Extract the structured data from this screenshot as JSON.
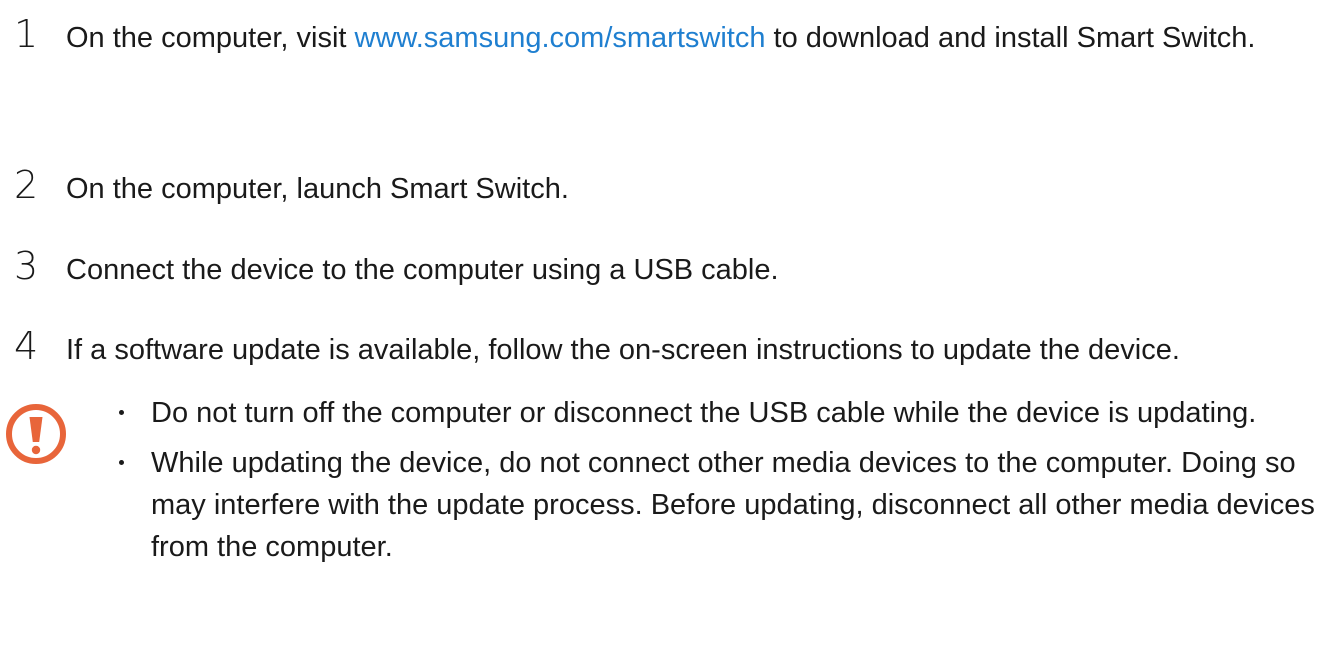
{
  "steps": [
    {
      "number": "1",
      "text_before": "On the computer, visit ",
      "link_text": "www.samsung.com/smartswitch",
      "text_after": " to download and install Smart Switch."
    },
    {
      "number": "2",
      "text": "On the computer, launch Smart Switch."
    },
    {
      "number": "3",
      "text": "Connect the device to the computer using a USB cable."
    },
    {
      "number": "4",
      "text": "If a software update is available, follow the on-screen instructions to update the device."
    }
  ],
  "notice": {
    "icon": "warning-exclamation-icon",
    "icon_color": "#e8653a",
    "bullets": [
      "Do not turn off the computer or disconnect the USB cable while the device is updating.",
      "While updating the device, do not connect other media devices to the computer. Doing so may interfere with the update process. Before updating, disconnect all other media devices from the computer."
    ]
  },
  "colors": {
    "link": "#1f7fd0",
    "text": "#1a1a1a"
  }
}
